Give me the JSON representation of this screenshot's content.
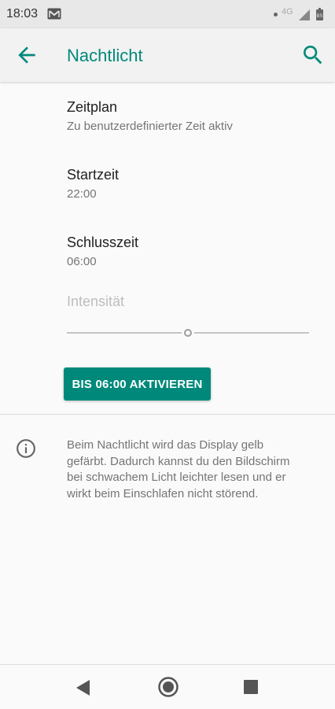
{
  "status_bar": {
    "time": "18:03",
    "network": "4G",
    "notification_icon": "gmail-icon",
    "battery_icon": "battery-saver-icon"
  },
  "app_bar": {
    "title": "Nachtlicht",
    "back_icon": "arrow-back-icon",
    "search_icon": "search-icon"
  },
  "preferences": {
    "schedule": {
      "title": "Zeitplan",
      "summary": "Zu benutzerdefinierter Zeit aktiv"
    },
    "start_time": {
      "title": "Startzeit",
      "summary": "22:00"
    },
    "end_time": {
      "title": "Schlusszeit",
      "summary": "06:00"
    }
  },
  "intensity": {
    "label": "Intensität",
    "value_fraction": 0.5,
    "enabled": false
  },
  "action_button": {
    "label": "BIS 06:00 AKTIVIEREN"
  },
  "info": {
    "icon": "info-icon",
    "lines": [
      "Beim Nachtlicht wird das Display gelb",
      "gefärbt. Dadurch kannst du den Bildschirm",
      "bei schwachem Licht leichter lesen und er",
      "wirkt beim Einschlafen nicht störend."
    ]
  },
  "nav_bar": {
    "back_icon": "nav-back-icon",
    "home_icon": "nav-home-icon",
    "recents_icon": "nav-recents-icon"
  },
  "colors": {
    "accent": "#00897b",
    "app_bar_bg": "#f2f2f2",
    "background": "#fafafa",
    "text_primary": "#212121",
    "text_secondary": "#757575"
  }
}
